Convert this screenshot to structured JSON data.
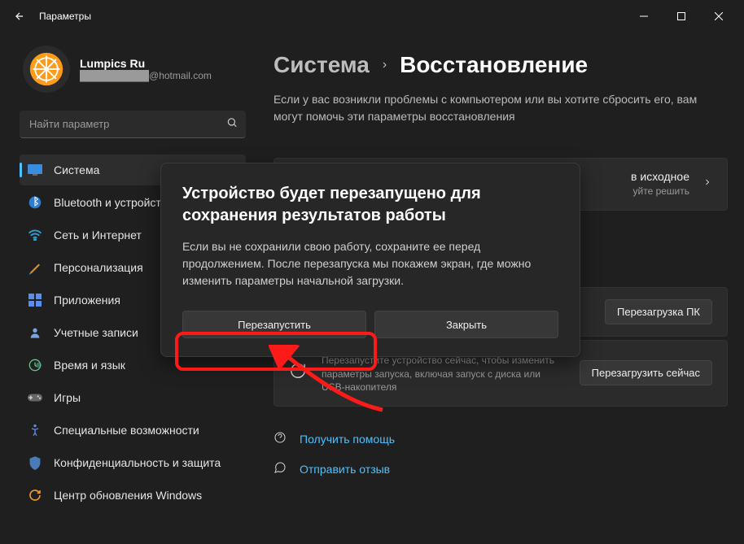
{
  "titlebar": {
    "title": "Параметры"
  },
  "profile": {
    "name": "Lumpics Ru",
    "email_masked": "██████████",
    "email_suffix": "@hotmail.com"
  },
  "search": {
    "placeholder": "Найти параметр"
  },
  "nav": {
    "items": [
      {
        "label": "Система",
        "icon": "system"
      },
      {
        "label": "Bluetooth и устройства",
        "icon": "bluetooth"
      },
      {
        "label": "Сеть и Интернет",
        "icon": "wifi"
      },
      {
        "label": "Персонализация",
        "icon": "personalization"
      },
      {
        "label": "Приложения",
        "icon": "apps"
      },
      {
        "label": "Учетные записи",
        "icon": "accounts"
      },
      {
        "label": "Время и язык",
        "icon": "time"
      },
      {
        "label": "Игры",
        "icon": "games"
      },
      {
        "label": "Специальные возможности",
        "icon": "accessibility"
      },
      {
        "label": "Конфиденциальность и защита",
        "icon": "privacy"
      },
      {
        "label": "Центр обновления Windows",
        "icon": "update"
      }
    ],
    "active_index": 0
  },
  "breadcrumb": {
    "parent": "Система",
    "current": "Восстановление"
  },
  "description": "Если у вас возникли проблемы с компьютером или вы хотите сбросить его, вам могут помочь эти параметры восстановления",
  "cards": {
    "reset": {
      "title_fragment": "в исходное",
      "sub_fragment": "уйте решить"
    },
    "advanced": {
      "sub": "Перезапустите устройство сейчас, чтобы изменить параметры запуска, включая запуск с диска или USB-накопителя",
      "button": "Перезагрузить сейчас",
      "other_button": "Перезагрузка ПК"
    }
  },
  "links": {
    "help": "Получить помощь",
    "feedback": "Отправить отзыв"
  },
  "dialog": {
    "title": "Устройство будет перезапущено для сохранения результатов работы",
    "body": "Если вы не сохранили свою работу, сохраните ее перед продолжением. После перезапуска мы покажем экран, где можно изменить параметры начальной загрузки.",
    "restart": "Перезапустить",
    "close": "Закрыть"
  }
}
